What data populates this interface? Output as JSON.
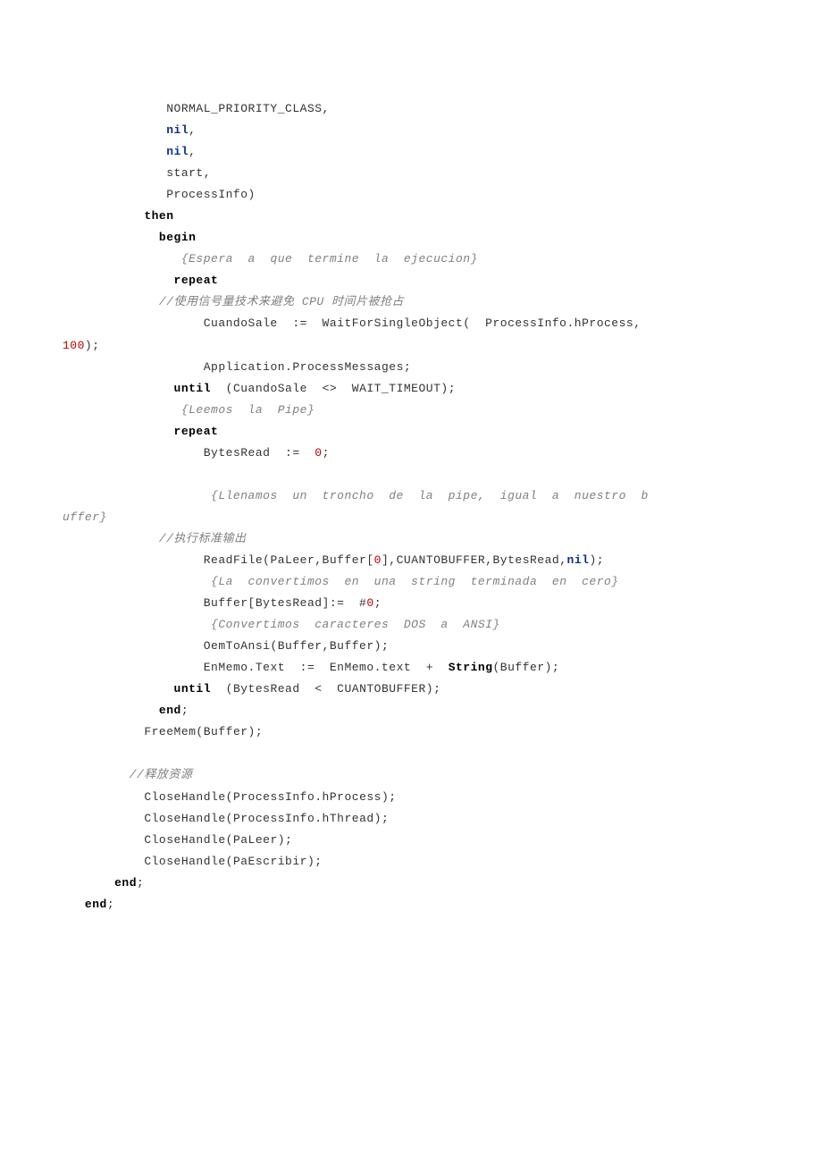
{
  "lines": [
    {
      "indent": 14,
      "segments": [
        {
          "cls": "plain",
          "text": "NORMAL_PRIORITY_CLASS,"
        }
      ]
    },
    {
      "indent": 14,
      "segments": [
        {
          "cls": "blue",
          "text": "nil"
        },
        {
          "cls": "plain",
          "text": ","
        }
      ]
    },
    {
      "indent": 14,
      "segments": [
        {
          "cls": "blue",
          "text": "nil"
        },
        {
          "cls": "plain",
          "text": ","
        }
      ]
    },
    {
      "indent": 14,
      "segments": [
        {
          "cls": "plain",
          "text": "start,"
        }
      ]
    },
    {
      "indent": 14,
      "segments": [
        {
          "cls": "plain",
          "text": "ProcessInfo)"
        }
      ]
    },
    {
      "indent": 11,
      "segments": [
        {
          "cls": "kw",
          "text": "then"
        }
      ]
    },
    {
      "indent": 13,
      "segments": [
        {
          "cls": "kw",
          "text": "begin"
        }
      ]
    },
    {
      "indent": 16,
      "segments": [
        {
          "cls": "comment-it",
          "text": "{Espera  a  que  termine  la  ejecucion}"
        }
      ]
    },
    {
      "indent": 15,
      "segments": [
        {
          "cls": "kw",
          "text": "repeat"
        }
      ]
    },
    {
      "indent": 13,
      "segments": [
        {
          "cls": "comment-zh",
          "text": "//使用信号量技术来避免 CPU 时间片被抢占"
        }
      ]
    },
    {
      "indent": 0,
      "wrap": true,
      "segments": [
        {
          "cls": "plain",
          "text": "                   CuandoSale  :=  WaitForSingleObject(  ProcessInfo.hProcess,  "
        }
      ],
      "wrapSegments": [
        {
          "cls": "red",
          "text": "100"
        },
        {
          "cls": "plain",
          "text": ");"
        }
      ]
    },
    {
      "indent": 19,
      "segments": [
        {
          "cls": "plain",
          "text": "Application.ProcessMessages;"
        }
      ]
    },
    {
      "indent": 15,
      "segments": [
        {
          "cls": "kw",
          "text": "until"
        },
        {
          "cls": "plain",
          "text": "  (CuandoSale  <>  WAIT_TIMEOUT);"
        }
      ]
    },
    {
      "indent": 16,
      "segments": [
        {
          "cls": "comment-it",
          "text": "{Leemos  la  Pipe}"
        }
      ]
    },
    {
      "indent": 15,
      "segments": [
        {
          "cls": "kw",
          "text": "repeat"
        }
      ]
    },
    {
      "indent": 19,
      "segments": [
        {
          "cls": "plain",
          "text": "BytesRead  :=  "
        },
        {
          "cls": "red",
          "text": "0"
        },
        {
          "cls": "plain",
          "text": ";"
        }
      ]
    },
    {
      "blank": true
    },
    {
      "indent": 0,
      "wrap": true,
      "segments": [
        {
          "cls": "comment-it",
          "text": "                    {Llenamos  un  troncho  de  la  pipe,  igual  a  nuestro  b"
        }
      ],
      "wrapSegments": [
        {
          "cls": "comment-it",
          "text": "uffer}"
        }
      ]
    },
    {
      "indent": 13,
      "segments": [
        {
          "cls": "comment-zh",
          "text": "//执行标准输出"
        }
      ]
    },
    {
      "indent": 19,
      "segments": [
        {
          "cls": "plain",
          "text": "ReadFile(PaLeer,Buffer["
        },
        {
          "cls": "red",
          "text": "0"
        },
        {
          "cls": "plain",
          "text": "],CUANTOBUFFER,BytesRead,"
        },
        {
          "cls": "blue",
          "text": "nil"
        },
        {
          "cls": "plain",
          "text": ");"
        }
      ]
    },
    {
      "indent": 20,
      "segments": [
        {
          "cls": "comment-it",
          "text": "{La  convertimos  en  una  string  terminada  en  cero}"
        }
      ]
    },
    {
      "indent": 19,
      "segments": [
        {
          "cls": "plain",
          "text": "Buffer[BytesRead]:=  #"
        },
        {
          "cls": "red",
          "text": "0"
        },
        {
          "cls": "plain",
          "text": ";"
        }
      ]
    },
    {
      "indent": 20,
      "segments": [
        {
          "cls": "comment-it",
          "text": "{Convertimos  caracteres  DOS  a  ANSI}"
        }
      ]
    },
    {
      "indent": 19,
      "segments": [
        {
          "cls": "plain",
          "text": "OemToAnsi(Buffer,Buffer);"
        }
      ]
    },
    {
      "indent": 19,
      "segments": [
        {
          "cls": "plain",
          "text": "EnMemo.Text  :=  EnMemo.text  +  "
        },
        {
          "cls": "kw",
          "text": "String"
        },
        {
          "cls": "plain",
          "text": "(Buffer);"
        }
      ]
    },
    {
      "indent": 15,
      "segments": [
        {
          "cls": "kw",
          "text": "until"
        },
        {
          "cls": "plain",
          "text": "  (BytesRead  <  CUANTOBUFFER);"
        }
      ]
    },
    {
      "indent": 13,
      "segments": [
        {
          "cls": "kw",
          "text": "end"
        },
        {
          "cls": "plain",
          "text": ";"
        }
      ]
    },
    {
      "indent": 11,
      "segments": [
        {
          "cls": "plain",
          "text": "FreeMem(Buffer);"
        }
      ]
    },
    {
      "blank": true
    },
    {
      "indent": 9,
      "segments": [
        {
          "cls": "comment-zh",
          "text": "//释放资源"
        }
      ]
    },
    {
      "indent": 11,
      "segments": [
        {
          "cls": "plain",
          "text": "CloseHandle(ProcessInfo.hProcess);"
        }
      ]
    },
    {
      "indent": 11,
      "segments": [
        {
          "cls": "plain",
          "text": "CloseHandle(ProcessInfo.hThread);"
        }
      ]
    },
    {
      "indent": 11,
      "segments": [
        {
          "cls": "plain",
          "text": "CloseHandle(PaLeer);"
        }
      ]
    },
    {
      "indent": 11,
      "segments": [
        {
          "cls": "plain",
          "text": "CloseHandle(PaEscribir);"
        }
      ]
    },
    {
      "indent": 7,
      "segments": [
        {
          "cls": "kw",
          "text": "end"
        },
        {
          "cls": "plain",
          "text": ";"
        }
      ]
    },
    {
      "indent": 3,
      "segments": [
        {
          "cls": "kw",
          "text": "end"
        },
        {
          "cls": "plain",
          "text": ";"
        }
      ]
    }
  ]
}
